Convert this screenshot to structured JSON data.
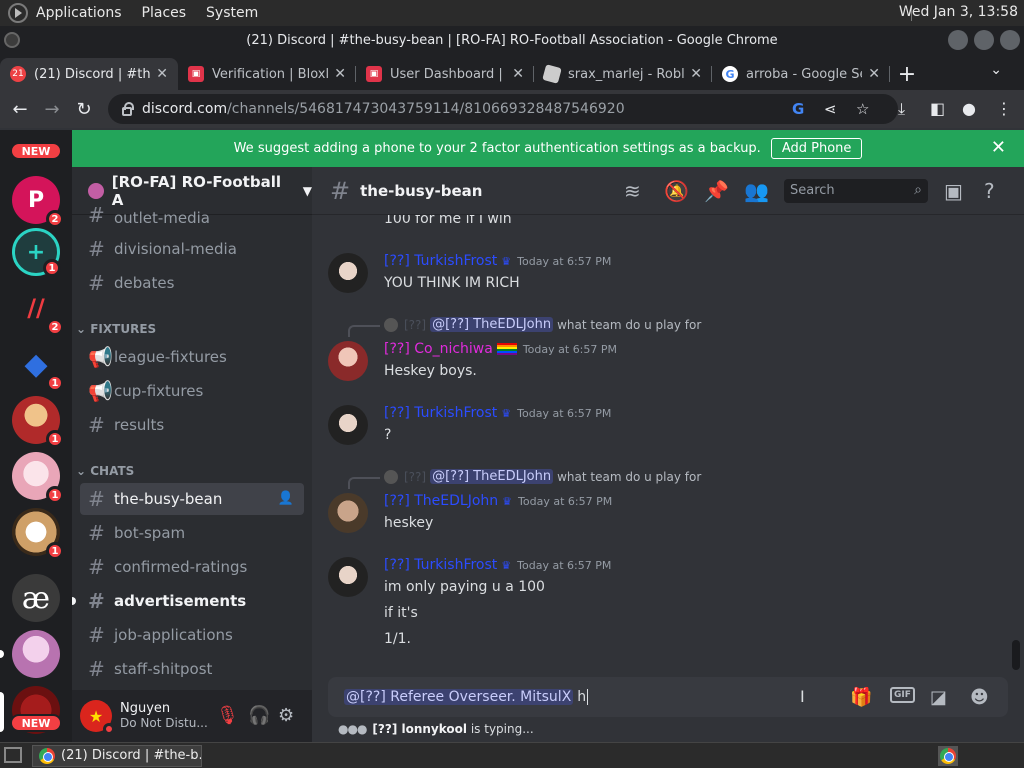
{
  "os": {
    "menus": [
      "Applications",
      "Places",
      "System"
    ],
    "clock": "Wed Jan  3, 13:58"
  },
  "window": {
    "title": "(21) Discord | #the-busy-bean | [RO-FA] RO-Football Association - Google Chrome"
  },
  "tabs": [
    {
      "title": "(21) Discord | #the-",
      "favicon_text": "21",
      "color": "#ed4245"
    },
    {
      "title": "Verification | Bloxli",
      "favicon_text": "",
      "color": "#e0344a"
    },
    {
      "title": "User Dashboard | B",
      "favicon_text": "",
      "color": "#e0344a"
    },
    {
      "title": "srax_marlej - Robl",
      "favicon_text": "",
      "color": "#cccccc"
    },
    {
      "title": "arroba - Google Se",
      "favicon_text": "G",
      "color": "#ffffff"
    }
  ],
  "address": {
    "host": "discord.com",
    "path": "/channels/546817473043759114/810669328487546920"
  },
  "banner": {
    "text": "We suggest adding a phone to your 2 factor authentication settings as a backup.",
    "button": "Add Phone"
  },
  "guilds": {
    "new_label": "NEW",
    "items": [
      {
        "letter": "P",
        "color": "#d4145a",
        "badge": "2"
      },
      {
        "letter": "+",
        "color": "#1f3d3e",
        "badge": "1"
      },
      {
        "letter": "//",
        "color": "#1e1f22",
        "badge": "2"
      },
      {
        "letter": "◆",
        "color": "#1e1f22",
        "badge": "1"
      },
      {
        "letter": "",
        "color": "#b02a2a",
        "badge": "1"
      },
      {
        "letter": "",
        "color": "#e9c9d3",
        "badge": "1"
      },
      {
        "letter": "",
        "color": "#cfa068",
        "badge": "1"
      },
      {
        "letter": "æ",
        "color": "#3a3a3a",
        "badge": ""
      },
      {
        "letter": "",
        "color": "#d8a6d0",
        "badge": ""
      },
      {
        "letter": "",
        "color": "#6b1010",
        "badge": ""
      }
    ]
  },
  "server": {
    "name": "[RO-FA] RO-Football A"
  },
  "channels": {
    "partial_top": "outlet-media",
    "group1": [
      "divisional-media",
      "debates"
    ],
    "cat_fixtures": "FIXTURES",
    "fixtures": [
      "league-fixtures",
      "cup-fixtures",
      "results"
    ],
    "cat_chats": "CHATS",
    "chats": [
      "the-busy-bean",
      "bot-spam",
      "confirmed-ratings",
      "advertisements",
      "job-applications",
      "staff-shitpost"
    ]
  },
  "user": {
    "name": "Nguyen",
    "status": "Do Not Distu..."
  },
  "chat": {
    "channel": "the-busy-bean",
    "search_placeholder": "Search"
  },
  "messages": [
    {
      "kind": "partial",
      "text": "100 for me if I win"
    },
    {
      "user": "[??] TurkishFrost",
      "time": "Today at 6:57 PM",
      "lines": [
        "YOU THINK IM RICH"
      ]
    },
    {
      "reply_mention": "@[??] TheEDLJohn",
      "reply_text": "what team do u play for",
      "user": "[??] Co_nichiwa",
      "time": "Today at 6:57 PM",
      "lines": [
        "Heskey boys."
      ]
    },
    {
      "user": "[??] TurkishFrost",
      "time": "Today at 6:57 PM",
      "lines": [
        "?"
      ]
    },
    {
      "reply_mention": "@[??] TheEDLJohn",
      "reply_text": "what team do u play for",
      "user": "[??] TheEDLJohn",
      "time": "Today at 6:57 PM",
      "lines": [
        "heskey"
      ]
    },
    {
      "user": "[??] TurkishFrost",
      "time": "Today at 6:57 PM",
      "lines": [
        "im only paying u a 100",
        "if it's",
        "1/1."
      ]
    }
  ],
  "composer": {
    "mention": "@[??] Referee Overseer. MitsulX",
    "typed": "h"
  },
  "typing": {
    "user": "[??] lonnykool",
    "suffix": "is typing..."
  },
  "taskbar": {
    "task": "(21) Discord | #the-b..."
  }
}
